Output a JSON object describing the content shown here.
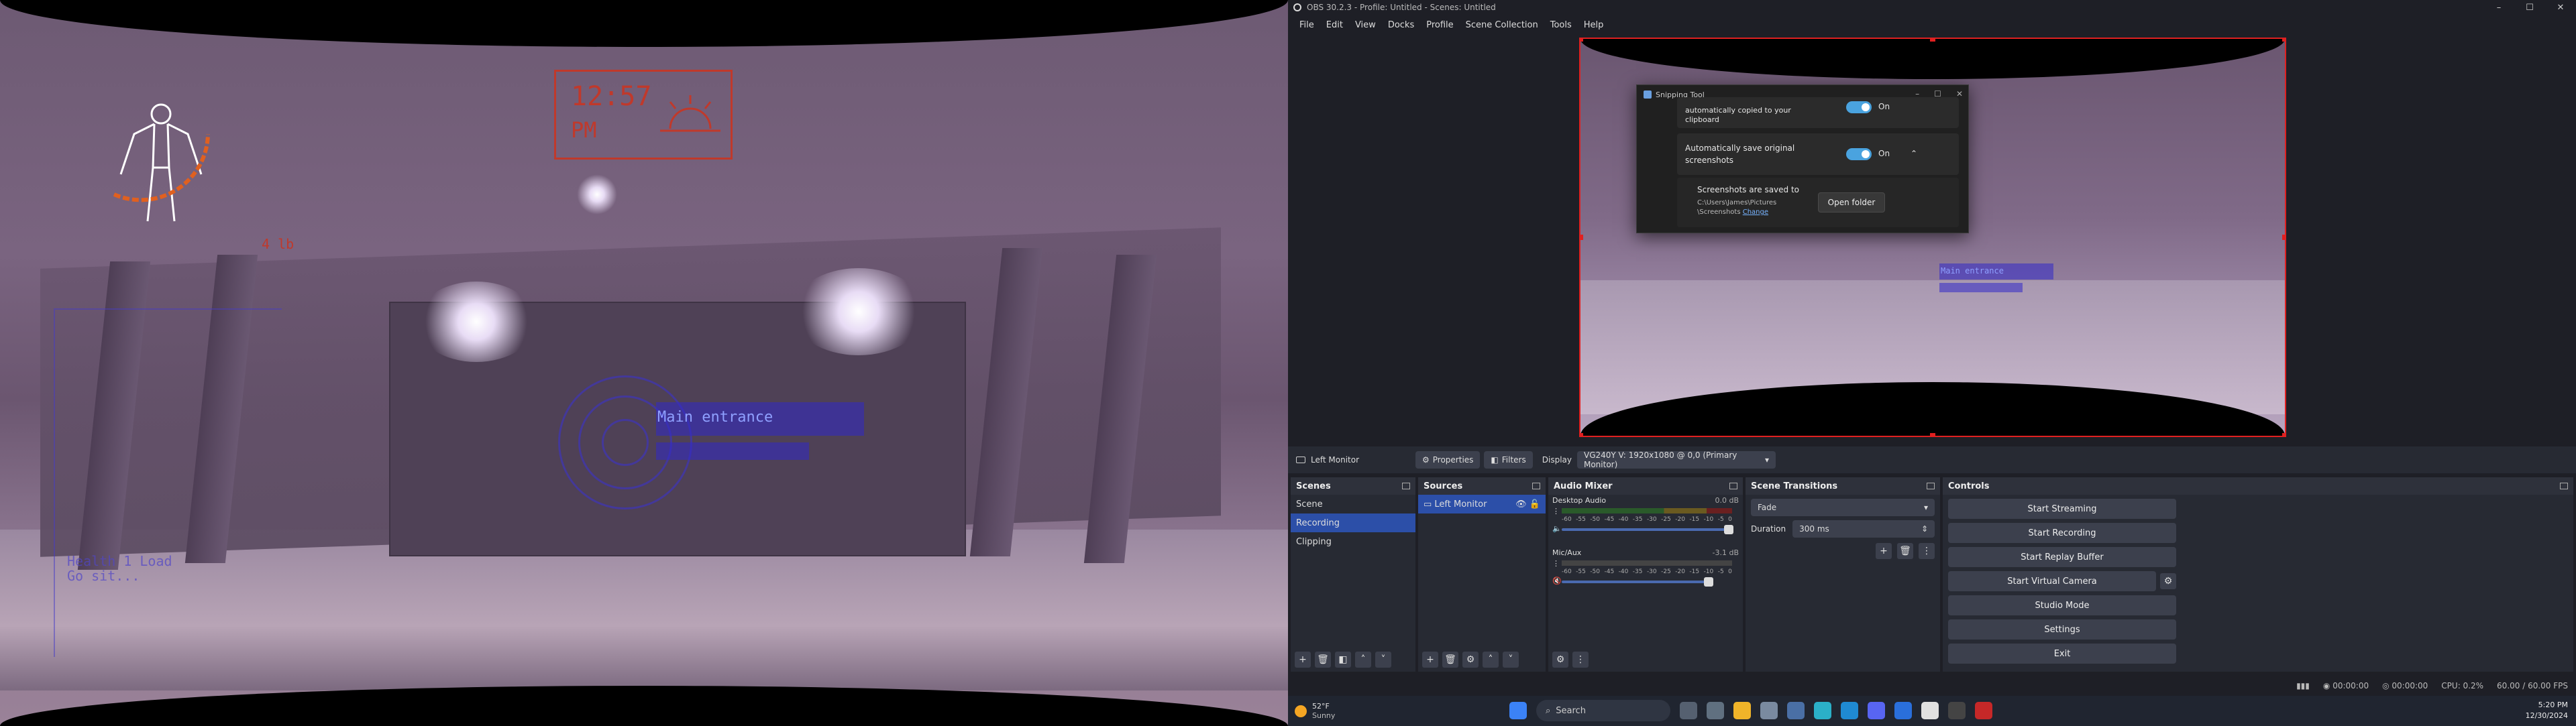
{
  "game": {
    "clock_time": "12:57",
    "clock_ampm": "PM",
    "hud_label": "Main entrance",
    "weight_label": "4 lb",
    "hint_lines": [
      "Health 1 Load",
      "Go sit..."
    ]
  },
  "obs": {
    "window_title": "OBS 30.2.3 - Profile: Untitled - Scenes: Untitled",
    "menu": [
      "File",
      "Edit",
      "View",
      "Docks",
      "Profile",
      "Scene Collection",
      "Tools",
      "Help"
    ],
    "snipping": {
      "title": "Snipping Tool",
      "copy_text_1": "automatically copied to your",
      "copy_text_2": "clipboard",
      "toggle1_state": "On",
      "save_label_1": "Automatically save original",
      "save_label_2": "screenshots",
      "toggle2_state": "On",
      "saved_to": "Screenshots are saved to",
      "path_1": "C:\\Users\\James\\Pictures",
      "path_2": "\\Screenshots",
      "change_link": "Change",
      "open_folder": "Open folder"
    },
    "preview_tag": "Main entrance",
    "source_toolbar": {
      "source_name": "Left Monitor",
      "properties": "Properties",
      "filters": "Filters",
      "display_label": "Display",
      "display_value": "VG240Y V: 1920x1080 @ 0,0 (Primary Monitor)"
    },
    "scenes": {
      "title": "Scenes",
      "items": [
        "Scene",
        "Recording",
        "Clipping"
      ],
      "selected": 1
    },
    "sources": {
      "title": "Sources",
      "items": [
        "Left Monitor"
      ]
    },
    "audio": {
      "title": "Audio Mixer",
      "channels": [
        {
          "name": "Desktop Audio",
          "db": "0.0 dB",
          "volume": 1.0
        },
        {
          "name": "Mic/Aux",
          "db": "-3.1 dB",
          "volume": 0.88
        }
      ],
      "scale": [
        "-60",
        "-55",
        "-50",
        "-45",
        "-40",
        "-35",
        "-30",
        "-25",
        "-20",
        "-15",
        "-10",
        "-5",
        "0"
      ]
    },
    "transitions": {
      "title": "Scene Transitions",
      "type": "Fade",
      "duration_label": "Duration",
      "duration_value": "300 ms"
    },
    "controls": {
      "title": "Controls",
      "buttons": [
        "Start Streaming",
        "Start Recording",
        "Start Replay Buffer",
        "Start Virtual Camera",
        "Studio Mode",
        "Settings",
        "Exit"
      ]
    },
    "status": {
      "rec_time": "00:00:00",
      "stream_time": "00:00:00",
      "cpu": "CPU: 0.2%",
      "fps": "60.00 / 60.00 FPS"
    }
  },
  "taskbar": {
    "temp": "52°F",
    "weather": "Sunny",
    "search": "Search",
    "time": "5:20 PM",
    "date": "12/30/2024"
  }
}
